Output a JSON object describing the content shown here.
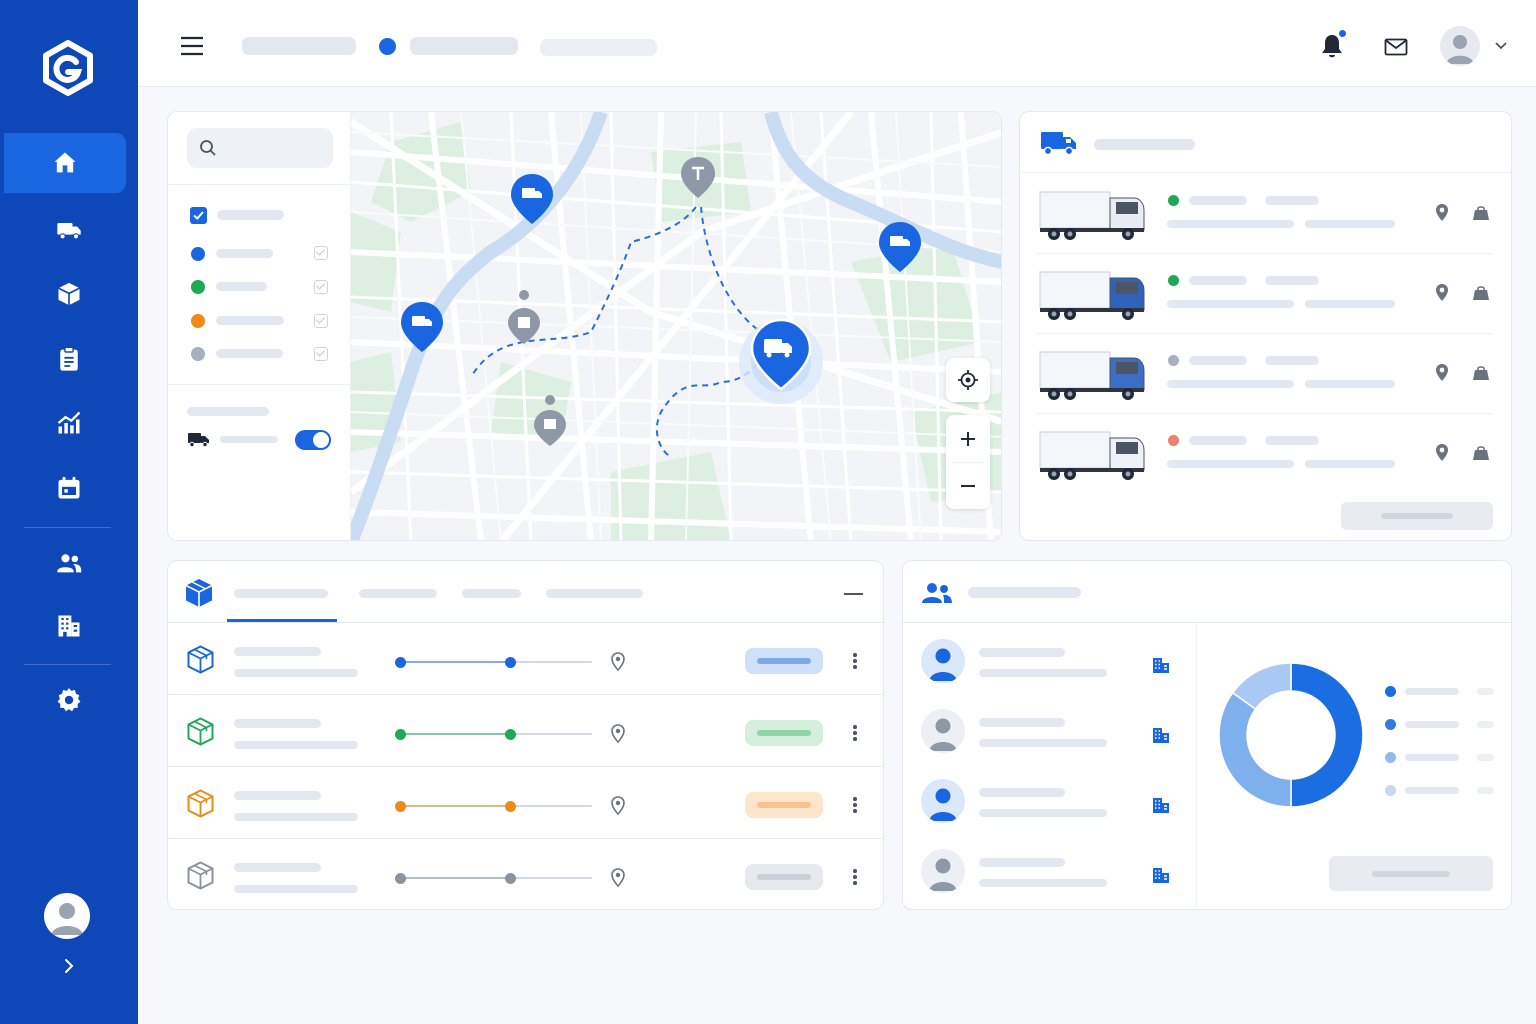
{
  "sidebar": {
    "logo_icon": "hexagon-g-logo-icon",
    "items": [
      {
        "name": "home",
        "icon": "home-icon",
        "active": true
      },
      {
        "name": "fleet",
        "icon": "truck-icon"
      },
      {
        "name": "packages",
        "icon": "box-icon"
      },
      {
        "name": "orders",
        "icon": "clipboard-icon"
      },
      {
        "name": "analytics",
        "icon": "chart-icon"
      },
      {
        "name": "schedule",
        "icon": "calendar-icon"
      },
      {
        "name": "drivers",
        "icon": "users-icon"
      },
      {
        "name": "warehouses",
        "icon": "building-icon"
      },
      {
        "name": "settings",
        "icon": "gear-icon"
      }
    ],
    "expand_icon": "chevron-right-icon"
  },
  "header": {
    "menu_icon": "hamburger-icon",
    "status_dot_color": "#1a66e0",
    "notification_icon": "bell-icon",
    "mail_icon": "mail-icon",
    "avatar_icon": "avatar-icon",
    "dropdown_icon": "chevron-down-icon"
  },
  "map_panel": {
    "search_icon": "search-icon",
    "filters": [
      {
        "color": "#1a66e0",
        "checked": true
      },
      {
        "color": "#1fa855",
        "checked": true
      },
      {
        "color": "#f08a12",
        "checked": true
      },
      {
        "color": "#a8b0bd",
        "checked": true
      }
    ],
    "live_toggle": true,
    "controls": [
      "locate-icon",
      "zoom-in-icon",
      "zoom-out-icon"
    ]
  },
  "fleet_panel": {
    "header_icon": "truck-icon",
    "vehicles": [
      {
        "status_color": "#1fa855",
        "cab_color": "#e9edf3"
      },
      {
        "status_color": "#1fa855",
        "cab_color": "#2f63b8"
      },
      {
        "status_color": "#a8b0bd",
        "cab_color": "#3a6fc4"
      },
      {
        "status_color": "#f2806e",
        "cab_color": "#eef1f5"
      }
    ]
  },
  "shipments_panel": {
    "header_icon": "package-icon",
    "tabs": 4,
    "active_tab": 0,
    "rows": [
      {
        "color": "#1a66e0",
        "pill_bg": "#cfe0fb",
        "pill_bar": "#7ea8ea"
      },
      {
        "color": "#1fa855",
        "pill_bg": "#d4f0dc",
        "pill_bar": "#8fd6a7"
      },
      {
        "color": "#f08a12",
        "pill_bg": "#fde6cc",
        "pill_bar": "#f6c48a"
      },
      {
        "color": "#8a93a0",
        "pill_bg": "#e6e9ee",
        "pill_bar": "#c9cfd8"
      }
    ]
  },
  "drivers_panel": {
    "header_icon": "users-icon",
    "drivers": [
      {
        "avatar_color": "#1a66e0",
        "avatar_bg": "#dbe7fb"
      },
      {
        "avatar_color": "#8f98a6",
        "avatar_bg": "#eceff3"
      },
      {
        "avatar_color": "#1a66e0",
        "avatar_bg": "#dbe7fb"
      },
      {
        "avatar_color": "#8f98a6",
        "avatar_bg": "#eceff3"
      }
    ],
    "chart_data": {
      "type": "pie",
      "values": [
        50,
        35,
        15
      ],
      "colors": [
        "#1b6de2",
        "#7fb0ee",
        "#a9c9f4"
      ],
      "legend_colors": [
        "#1b6de2",
        "#2f7be6",
        "#8fbaf0",
        "#c6d8f4"
      ]
    }
  }
}
